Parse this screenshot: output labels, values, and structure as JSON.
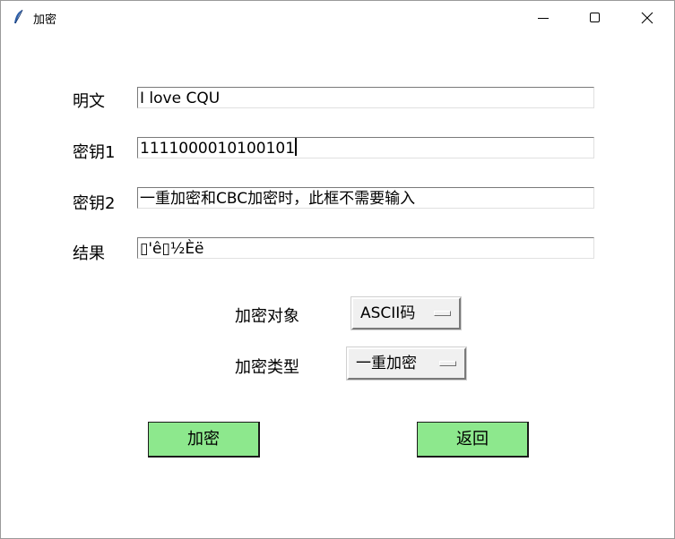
{
  "window": {
    "title": "加密"
  },
  "form": {
    "plaintext": {
      "label": "明文",
      "value": "I love CQU"
    },
    "key1": {
      "label": "密钥1",
      "value": "1111000010100101"
    },
    "key2": {
      "label": "密钥2",
      "value": "一重加密和CBC加密时，此框不需要输入"
    },
    "result": {
      "label": "结果",
      "value": "▯'ê▯½Èë"
    }
  },
  "options": {
    "target": {
      "label": "加密对象",
      "selected": "ASCII码"
    },
    "type": {
      "label": "加密类型",
      "selected": "一重加密"
    }
  },
  "actions": {
    "encrypt_label": "加密",
    "back_label": "返回"
  },
  "colors": {
    "button_bg": "#8de88d"
  }
}
